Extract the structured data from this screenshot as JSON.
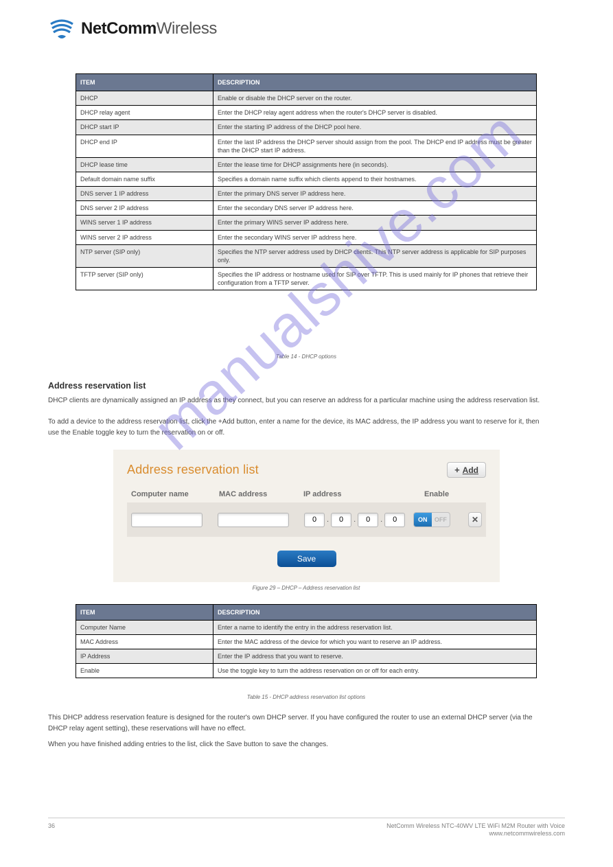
{
  "logo": {
    "bold": "NetComm",
    "light": "Wireless"
  },
  "dhcp_table": {
    "head": {
      "item": "ITEM",
      "desc": "DESCRIPTION"
    },
    "rows": [
      {
        "item": "DHCP",
        "desc": "Enable or disable the DHCP server on the router."
      },
      {
        "item": "DHCP relay agent",
        "desc": "Enter the DHCP relay agent address when the router's DHCP server is disabled."
      },
      {
        "item": "DHCP start IP",
        "desc": "Enter the starting IP address of the DHCP pool here."
      },
      {
        "item": "DHCP end IP",
        "desc": "Enter the last IP address the DHCP server should assign from the pool. The DHCP end IP address must be greater than the DHCP start IP address."
      },
      {
        "item": "DHCP lease time",
        "desc": "Enter the lease time for DHCP assignments here (in seconds)."
      },
      {
        "item": "Default domain name suffix",
        "desc": "Specifies a domain name suffix which clients append to their hostnames."
      },
      {
        "item": "DNS server 1 IP address",
        "desc": "Enter the primary DNS server IP address here."
      },
      {
        "item": "DNS server 2 IP address",
        "desc": "Enter the secondary DNS server IP address here."
      },
      {
        "item": "WINS server 1 IP address",
        "desc": "Enter the primary WINS server IP address here."
      },
      {
        "item": "WINS server 2 IP address",
        "desc": "Enter the secondary WINS server IP address here."
      },
      {
        "item": "NTP server (SIP only)",
        "desc": "Specifies the NTP server address used by DHCP clients. This NTP server address is applicable for SIP purposes only."
      },
      {
        "item": "TFTP server (SIP only)",
        "desc": "Specifies the IP address or hostname used for SIP over TFTP. This is used mainly for IP phones that retrieve their configuration from a TFTP server."
      }
    ],
    "caption": "Table 14 - DHCP options"
  },
  "section": {
    "heading": "Address reservation list",
    "intro": "DHCP clients are dynamically assigned an IP address as they connect, but you can reserve an address for a particular machine using the address reservation list.",
    "intro2": "To add a device to the address reservation list, click the +Add button, enter a name for the device, its MAC address, the IP address you want to reserve for it, then use the Enable toggle key to turn the reservation on or off."
  },
  "ui": {
    "title": "Address reservation list",
    "add": "Add",
    "cols": {
      "computer": "Computer name",
      "mac": "MAC address",
      "ip": "IP address",
      "enable": "Enable"
    },
    "ip_default": "0",
    "toggle_on": "ON",
    "toggle_off": "OFF",
    "save": "Save"
  },
  "figure_caption": "Figure 29 – DHCP – Address reservation list",
  "reservation_fields": {
    "head": {
      "item": "ITEM",
      "desc": "DESCRIPTION"
    },
    "rows": [
      {
        "item": "Computer Name",
        "desc": "Enter a name to identify the entry in the address reservation list."
      },
      {
        "item": "MAC Address",
        "desc": "Enter the MAC address of the device for which you want to reserve an IP address."
      },
      {
        "item": "IP Address",
        "desc": "Enter the IP address that you want to reserve."
      },
      {
        "item": "Enable",
        "desc": "Use the toggle key to turn the address reservation on or off for each entry."
      }
    ],
    "caption": "Table 15 - DHCP address reservation list options"
  },
  "closing": {
    "p1": "This DHCP address reservation feature is designed for the router's own DHCP server. If you have configured the router to use an external DHCP server (via the DHCP relay agent setting), these reservations will have no effect.",
    "p2": "When you have finished adding entries to the list, click the Save button to save the changes."
  },
  "footer": {
    "page": "36",
    "line1": "NetComm Wireless NTC-40WV LTE WiFi M2M Router with Voice",
    "line2": "www.netcommwireless.com"
  },
  "watermark": "manualshive.com"
}
